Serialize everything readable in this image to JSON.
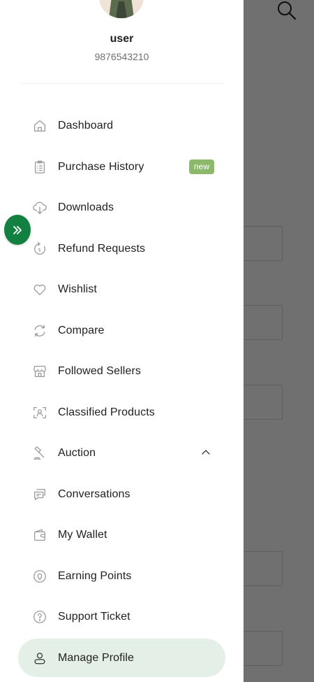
{
  "user": {
    "name": "user",
    "phone": "9876543210"
  },
  "menu": [
    {
      "label": "Dashboard",
      "icon": "home-icon"
    },
    {
      "label": "Purchase History",
      "icon": "clipboard-list-icon",
      "badge": "new"
    },
    {
      "label": "Downloads",
      "icon": "cloud-download-icon"
    },
    {
      "label": "Refund Requests",
      "icon": "refund-icon"
    },
    {
      "label": "Wishlist",
      "icon": "heart-icon"
    },
    {
      "label": "Compare",
      "icon": "refresh-icon"
    },
    {
      "label": "Followed Sellers",
      "icon": "store-icon"
    },
    {
      "label": "Classified Products",
      "icon": "scan-user-icon"
    },
    {
      "label": "Auction",
      "icon": "gavel-icon",
      "expanded": true
    },
    {
      "label": "Conversations",
      "icon": "chat-icon"
    },
    {
      "label": "My Wallet",
      "icon": "wallet-icon"
    },
    {
      "label": "Earning Points",
      "icon": "location-badge-icon"
    },
    {
      "label": "Support Ticket",
      "icon": "help-circle-icon"
    },
    {
      "label": "Manage Profile",
      "icon": "user-icon",
      "active": true
    }
  ],
  "colors": {
    "accent_green": "#128041",
    "badge_green": "#8bb86a",
    "active_bg": "#e4efe7"
  }
}
